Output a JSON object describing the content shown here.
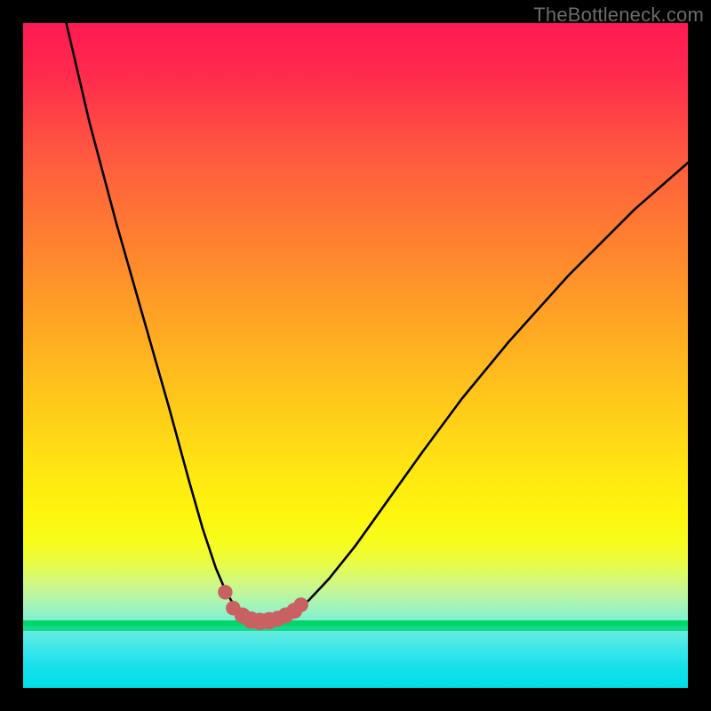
{
  "watermark": "TheBottleneck.com",
  "colors": {
    "curve_stroke": "#000000",
    "marker_fill": "#c96062",
    "green_band": "#00d66a"
  },
  "chart_data": {
    "type": "line",
    "title": "",
    "xlabel": "",
    "ylabel": "",
    "xlim": [
      0,
      100
    ],
    "ylim": [
      0,
      100
    ],
    "note": "Values in percent of plot area; y is measured from bottom (0) to top (100). Curve sampled from the image.",
    "series": [
      {
        "name": "curve",
        "x": [
          6.5,
          10,
          14,
          18,
          22,
          25,
          27,
          29,
          30.5,
          32,
          33.2,
          34.2,
          35,
          36,
          37,
          38,
          39.5,
          41,
          43,
          46,
          50,
          55,
          60,
          66,
          73,
          82,
          92,
          100
        ],
        "y": [
          100,
          85,
          70,
          56,
          42,
          31,
          24,
          18,
          14.5,
          12,
          10.8,
          10.2,
          10.0,
          10.0,
          10.1,
          10.3,
          10.8,
          11.6,
          13.2,
          16.4,
          21.4,
          28.4,
          35.4,
          43.5,
          52,
          62,
          72,
          79
        ]
      }
    ],
    "markers": [
      {
        "x": 30.4,
        "y": 14.4,
        "r": 1.1
      },
      {
        "x": 31.6,
        "y": 12.0,
        "r": 1.1
      },
      {
        "x": 33.0,
        "y": 10.9,
        "r": 1.2
      },
      {
        "x": 34.3,
        "y": 10.2,
        "r": 1.3
      },
      {
        "x": 35.6,
        "y": 10.0,
        "r": 1.3
      },
      {
        "x": 37.0,
        "y": 10.1,
        "r": 1.3
      },
      {
        "x": 38.3,
        "y": 10.4,
        "r": 1.2
      },
      {
        "x": 39.5,
        "y": 10.9,
        "r": 1.2
      },
      {
        "x": 40.8,
        "y": 11.6,
        "r": 1.2
      },
      {
        "x": 41.8,
        "y": 12.5,
        "r": 1.1
      }
    ]
  }
}
